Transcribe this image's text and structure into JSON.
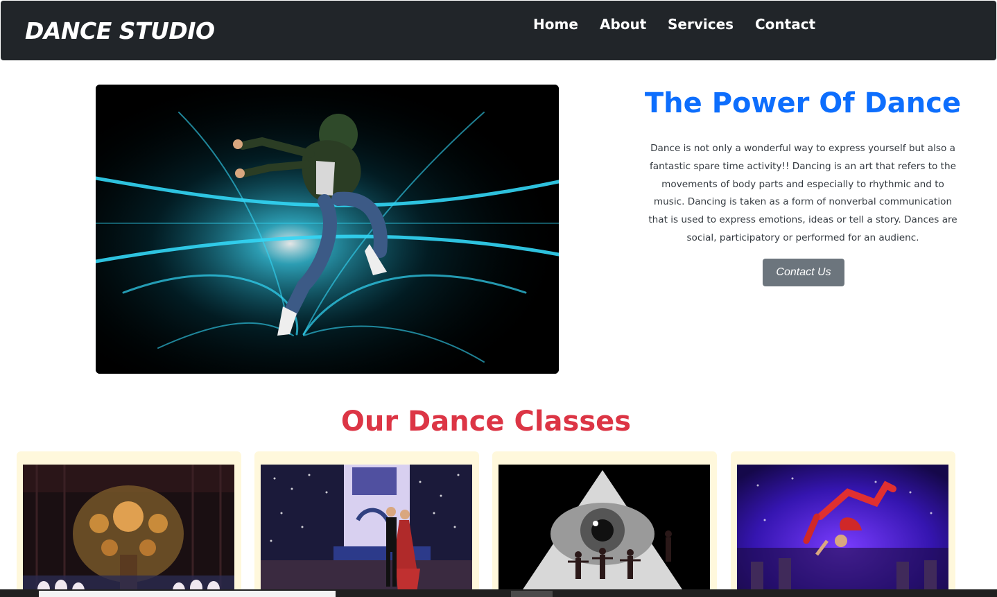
{
  "navbar": {
    "brand": "DANCE STUDIO",
    "links": [
      "Home",
      "About",
      "Services",
      "Contact"
    ]
  },
  "hero": {
    "title": "The Power Of Dance",
    "text": "Dance is not only a wonderful way to express yourself but also a fantastic spare time activity!! Dancing is an art that refers to the movements of body parts and especially to rhythmic and to music. Dancing is taken as a form of nonverbal communication that is used to express emotions, ideas or tell a story. Dances are social, participatory or performed for an audienc.",
    "button_label": "Contact Us"
  },
  "classes": {
    "title": "Our Dance Classes"
  },
  "colors": {
    "navbar_bg": "#212529",
    "hero_title": "#0d6efd",
    "section_title": "#dc3545",
    "button_bg": "#6c757d",
    "card_bg": "#fff8dc"
  }
}
